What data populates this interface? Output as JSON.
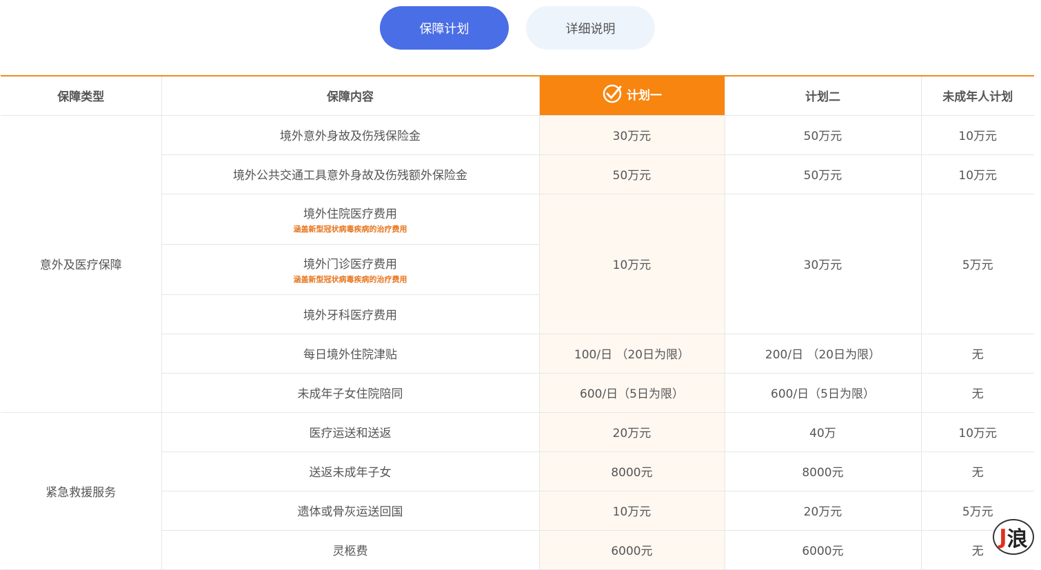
{
  "tabs": [
    {
      "label": "保障计划",
      "active": true
    },
    {
      "label": "详细说明",
      "active": false
    }
  ],
  "colors": {
    "accent": "#4a6ee6",
    "plan_highlight": "#f7850f",
    "note": "#e8741b"
  },
  "table": {
    "headers": {
      "type": "保障类型",
      "content": "保障内容",
      "plan1": "计划一",
      "plan2": "计划二",
      "minor": "未成年人计划"
    },
    "groups": [
      {
        "name": "意外及医疗保障"
      },
      {
        "name": "紧急救援服务"
      }
    ],
    "rows": [
      {
        "content": "境外意外身故及伤残保险金",
        "plan1": "30万元",
        "plan2": "50万元",
        "minor": "10万元"
      },
      {
        "content": "境外公共交通工具意外身故及伤残额外保险金",
        "plan1": "50万元",
        "plan2": "50万元",
        "minor": "10万元"
      },
      {
        "content": "境外住院医疗费用",
        "note": "涵盖新型冠状病毒疾病的治疗费用",
        "plan1": "10万元",
        "plan2": "30万元",
        "minor": "5万元"
      },
      {
        "content": "境外门诊医疗费用",
        "note": "涵盖新型冠状病毒疾病的治疗费用"
      },
      {
        "content": "境外牙科医疗费用"
      },
      {
        "content": "每日境外住院津贴",
        "plan1": "100/日 （20日为限）",
        "plan2": "200/日 （20日为限）",
        "minor": "无"
      },
      {
        "content": "未成年子女住院陪同",
        "plan1": "600/日（5日为限）",
        "plan2": "600/日（5日为限）",
        "minor": "无"
      },
      {
        "content": "医疗运送和送返",
        "plan1": "20万元",
        "plan2": "40万",
        "minor": "10万元"
      },
      {
        "content": "送返未成年子女",
        "plan1": "8000元",
        "plan2": "8000元",
        "minor": "无"
      },
      {
        "content": "遗体或骨灰运送回国",
        "plan1": "10万元",
        "plan2": "20万元",
        "minor": "5万元"
      },
      {
        "content": "灵柩费",
        "plan1": "6000元",
        "plan2": "6000元",
        "minor": "无"
      }
    ]
  },
  "badge": {
    "char": "浪",
    "icon": "brand-logo-icon"
  }
}
